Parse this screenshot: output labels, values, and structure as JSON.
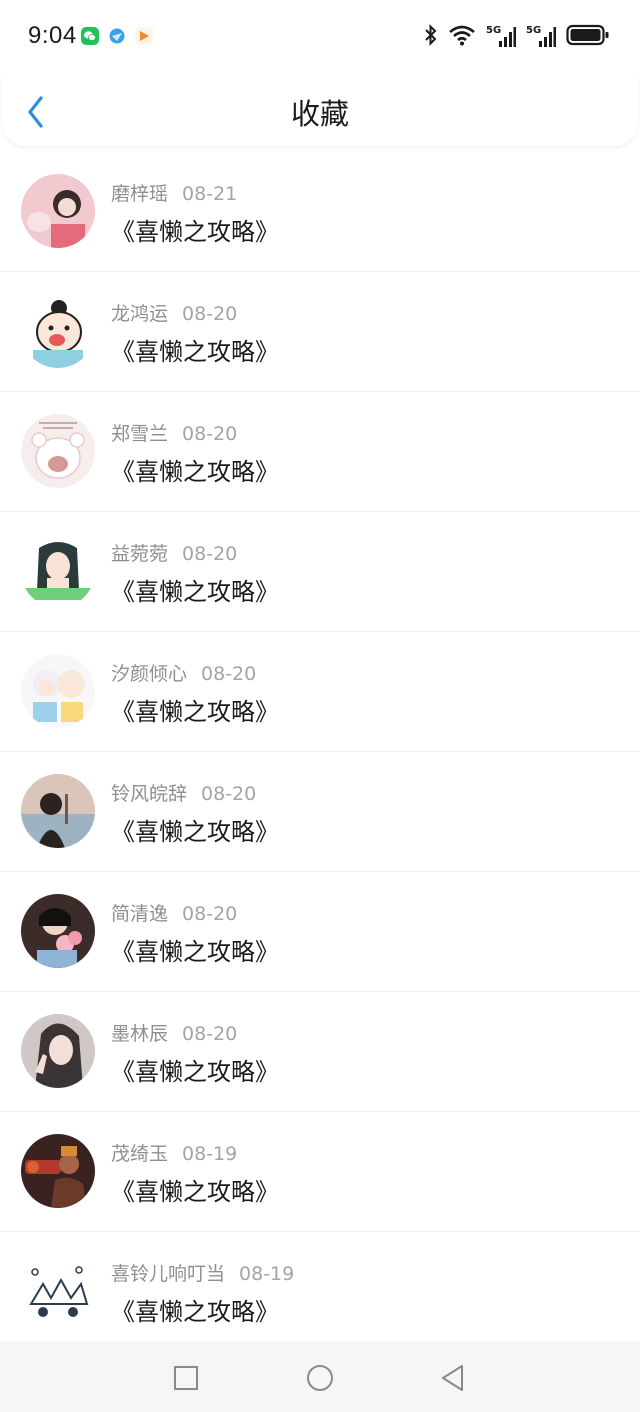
{
  "status": {
    "time": "9:04",
    "icons": [
      "wechat-icon",
      "browser-icon",
      "video-app-icon",
      "bluetooth-icon",
      "wifi-icon",
      "signal-5g-icon",
      "signal-5g-icon",
      "battery-icon"
    ],
    "signal_label_1": "5G",
    "signal_label_2": "5G"
  },
  "header": {
    "title": "收藏",
    "back_icon": "chevron-left-icon",
    "accent": "#2f8ddc"
  },
  "favorites": [
    {
      "user": "磨梓瑶",
      "date": "08-21",
      "title": "《喜懒之攻略》"
    },
    {
      "user": "龙鸿运",
      "date": "08-20",
      "title": "《喜懒之攻略》"
    },
    {
      "user": "郑雪兰",
      "date": "08-20",
      "title": "《喜懒之攻略》"
    },
    {
      "user": "益菀菀",
      "date": "08-20",
      "title": "《喜懒之攻略》"
    },
    {
      "user": "汐颜倾心",
      "date": "08-20",
      "title": "《喜懒之攻略》"
    },
    {
      "user": "铃风皖辞",
      "date": "08-20",
      "title": "《喜懒之攻略》"
    },
    {
      "user": "简清逸",
      "date": "08-20",
      "title": "《喜懒之攻略》"
    },
    {
      "user": "墨林辰",
      "date": "08-20",
      "title": "《喜懒之攻略》"
    },
    {
      "user": "茂绮玉",
      "date": "08-19",
      "title": "《喜懒之攻略》"
    },
    {
      "user": "喜铃儿响叮当",
      "date": "08-19",
      "title": "《喜懒之攻略》"
    }
  ],
  "nav": {
    "icons": [
      "square-recents-icon",
      "circle-home-icon",
      "triangle-back-icon"
    ]
  }
}
